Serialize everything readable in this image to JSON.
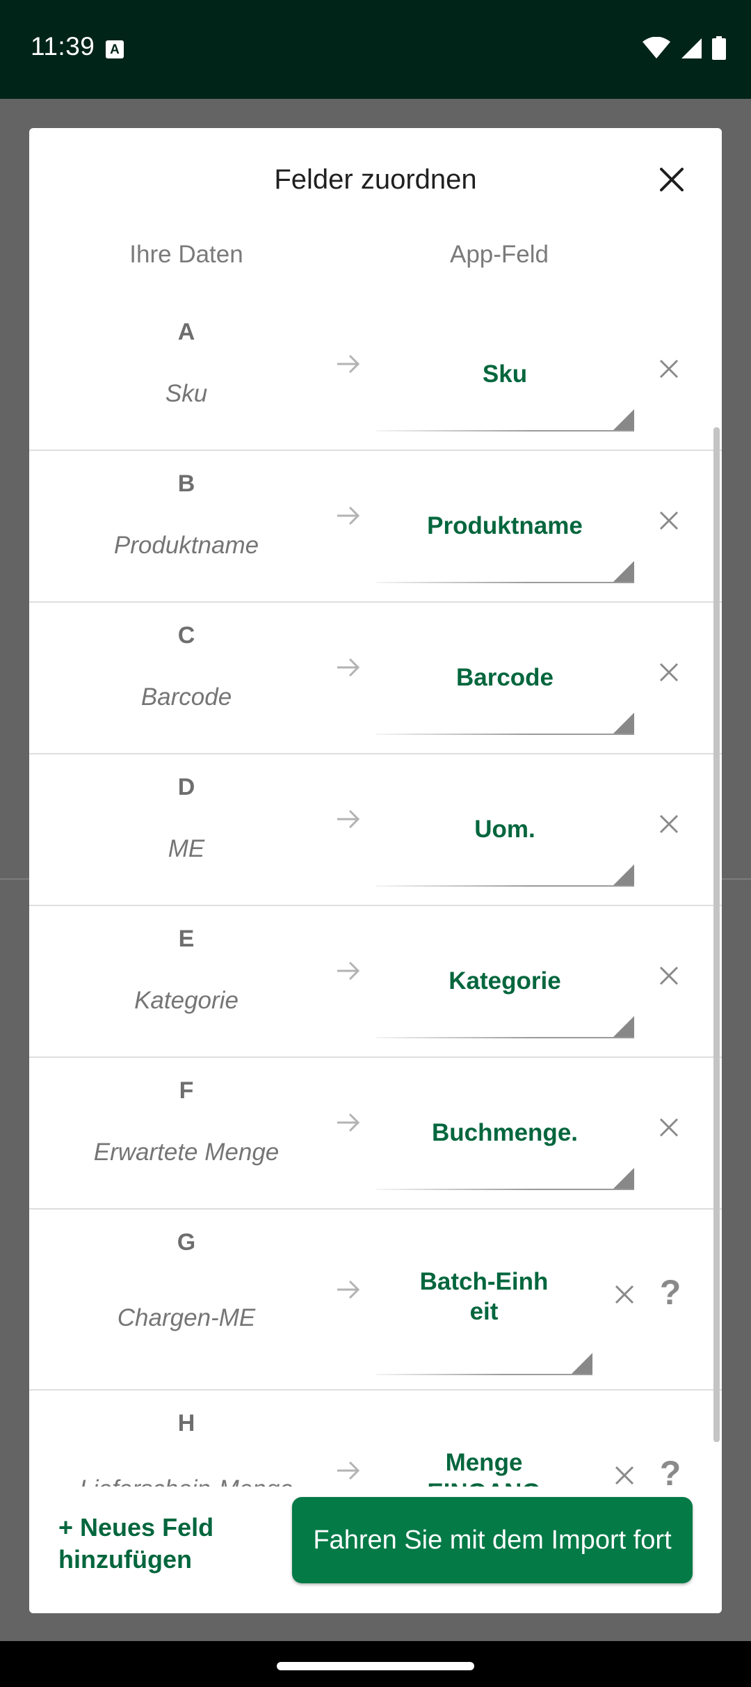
{
  "status_bar": {
    "time": "11:39",
    "notification_icon": "A"
  },
  "dialog": {
    "title": "Felder zuordnen",
    "column_left": "Ihre Daten",
    "column_right": "App-Feld",
    "rows": [
      {
        "letter": "A",
        "source": "Sku",
        "target": "Sku",
        "help": ""
      },
      {
        "letter": "B",
        "source": "Produktname",
        "target": "Produktname",
        "help": ""
      },
      {
        "letter": "C",
        "source": "Barcode",
        "target": "Barcode",
        "help": ""
      },
      {
        "letter": "D",
        "source": "ME",
        "target": "Uom.",
        "help": ""
      },
      {
        "letter": "E",
        "source": "Kategorie",
        "target": "Kategorie",
        "help": ""
      },
      {
        "letter": "F",
        "source": "Erwartete Menge",
        "target": "Buchmenge.",
        "help": ""
      },
      {
        "letter": "G",
        "source": "Chargen-ME",
        "target": "Batch-Einh\neit",
        "help": "?"
      },
      {
        "letter": "H",
        "source": "Lieferschein-Menge",
        "target": "Menge\nEINGANG",
        "help": "?"
      }
    ],
    "add_field_label": "+ Neues Feld hinzufügen",
    "continue_label": "Fahren Sie mit dem Import fort"
  },
  "icons": {
    "close": "close-icon",
    "arrow": "arrow-right-icon",
    "remove": "remove-x-icon",
    "dropdown": "dropdown-triangle-icon",
    "wifi": "wifi-icon",
    "signal": "signal-icon",
    "battery": "battery-icon"
  },
  "colors": {
    "status_bar": "#012419",
    "accent_green": "#03663d",
    "button_green": "#047a47",
    "scrim": "#646464"
  }
}
